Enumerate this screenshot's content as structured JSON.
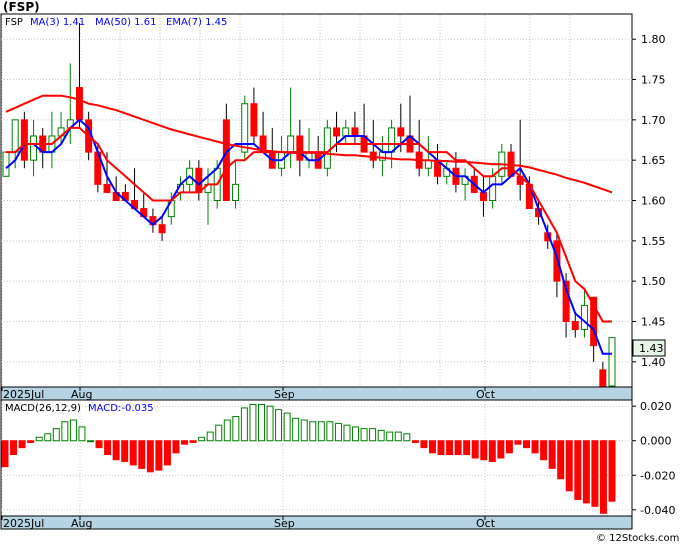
{
  "chart_data": [
    {
      "type": "candlestick",
      "title": "(FSP)",
      "legend": {
        "ticker": "FSP",
        "ma3": "MA(3)  1.41",
        "ma50": "MA(50)  1.61",
        "ema7": "EMA(7)  1.45"
      },
      "x_ticks": [
        "2025Jul",
        "Aug",
        "Sep",
        "Oct"
      ],
      "y_ticks": [
        "1.80",
        "1.75",
        "1.70",
        "1.65",
        "1.60",
        "1.55",
        "1.50",
        "1.45",
        "1.40"
      ],
      "ylim": [
        1.37,
        1.83
      ],
      "last_price": "1.43",
      "grid": true,
      "candles": [
        [
          1.63,
          1.66,
          1.63,
          1.66
        ],
        [
          1.66,
          1.7,
          1.64,
          1.7
        ],
        [
          1.7,
          1.71,
          1.64,
          1.65
        ],
        [
          1.65,
          1.7,
          1.63,
          1.68
        ],
        [
          1.68,
          1.69,
          1.64,
          1.66
        ],
        [
          1.66,
          1.71,
          1.64,
          1.68
        ],
        [
          1.68,
          1.71,
          1.67,
          1.69
        ],
        [
          1.69,
          1.77,
          1.67,
          1.7
        ],
        [
          1.74,
          1.82,
          1.69,
          1.7
        ],
        [
          1.7,
          1.71,
          1.65,
          1.66
        ],
        [
          1.66,
          1.67,
          1.61,
          1.62
        ],
        [
          1.62,
          1.66,
          1.61,
          1.61
        ],
        [
          1.61,
          1.63,
          1.6,
          1.6
        ],
        [
          1.61,
          1.62,
          1.6,
          1.6
        ],
        [
          1.6,
          1.64,
          1.59,
          1.59
        ],
        [
          1.59,
          1.61,
          1.58,
          1.58
        ],
        [
          1.58,
          1.59,
          1.56,
          1.57
        ],
        [
          1.57,
          1.58,
          1.55,
          1.56
        ],
        [
          1.58,
          1.61,
          1.57,
          1.6
        ],
        [
          1.61,
          1.63,
          1.6,
          1.62
        ],
        [
          1.62,
          1.65,
          1.61,
          1.64
        ],
        [
          1.64,
          1.65,
          1.6,
          1.61
        ],
        [
          1.61,
          1.64,
          1.57,
          1.62
        ],
        [
          1.6,
          1.65,
          1.59,
          1.64
        ],
        [
          1.7,
          1.72,
          1.64,
          1.6
        ],
        [
          1.6,
          1.65,
          1.59,
          1.62
        ],
        [
          1.66,
          1.73,
          1.65,
          1.72
        ],
        [
          1.72,
          1.74,
          1.67,
          1.68
        ],
        [
          1.68,
          1.71,
          1.66,
          1.66
        ],
        [
          1.66,
          1.69,
          1.64,
          1.64
        ],
        [
          1.64,
          1.68,
          1.63,
          1.66
        ],
        [
          1.66,
          1.74,
          1.64,
          1.68
        ],
        [
          1.68,
          1.7,
          1.63,
          1.65
        ],
        [
          1.65,
          1.69,
          1.64,
          1.66
        ],
        [
          1.66,
          1.68,
          1.64,
          1.64
        ],
        [
          1.64,
          1.7,
          1.63,
          1.69
        ],
        [
          1.69,
          1.71,
          1.66,
          1.68
        ],
        [
          1.68,
          1.7,
          1.67,
          1.69
        ],
        [
          1.69,
          1.71,
          1.67,
          1.68
        ],
        [
          1.68,
          1.72,
          1.66,
          1.66
        ],
        [
          1.66,
          1.7,
          1.64,
          1.65
        ],
        [
          1.65,
          1.68,
          1.63,
          1.66
        ],
        [
          1.66,
          1.7,
          1.64,
          1.69
        ],
        [
          1.69,
          1.72,
          1.66,
          1.68
        ],
        [
          1.68,
          1.73,
          1.66,
          1.66
        ],
        [
          1.66,
          1.7,
          1.63,
          1.64
        ],
        [
          1.64,
          1.68,
          1.63,
          1.65
        ],
        [
          1.65,
          1.67,
          1.62,
          1.63
        ],
        [
          1.63,
          1.65,
          1.62,
          1.64
        ],
        [
          1.64,
          1.66,
          1.61,
          1.62
        ],
        [
          1.62,
          1.64,
          1.6,
          1.63
        ],
        [
          1.63,
          1.64,
          1.61,
          1.61
        ],
        [
          1.61,
          1.63,
          1.58,
          1.6
        ],
        [
          1.6,
          1.64,
          1.59,
          1.63
        ],
        [
          1.63,
          1.67,
          1.62,
          1.66
        ],
        [
          1.66,
          1.67,
          1.63,
          1.63
        ],
        [
          1.63,
          1.7,
          1.6,
          1.62
        ],
        [
          1.62,
          1.63,
          1.59,
          1.59
        ],
        [
          1.59,
          1.6,
          1.57,
          1.58
        ],
        [
          1.56,
          1.57,
          1.54,
          1.55
        ],
        [
          1.55,
          1.56,
          1.48,
          1.5
        ],
        [
          1.5,
          1.51,
          1.43,
          1.45
        ],
        [
          1.45,
          1.46,
          1.43,
          1.44
        ],
        [
          1.44,
          1.49,
          1.43,
          1.47
        ],
        [
          1.48,
          1.48,
          1.4,
          1.42
        ],
        [
          1.39,
          1.4,
          1.36,
          1.36
        ],
        [
          1.37,
          1.43,
          1.37,
          1.43
        ]
      ],
      "series": [
        {
          "name": "MA(3)",
          "color": "#0000ff",
          "values": [
            1.64,
            1.65,
            1.67,
            1.67,
            1.66,
            1.66,
            1.67,
            1.69,
            1.7,
            1.69,
            1.66,
            1.63,
            1.61,
            1.6,
            1.59,
            1.58,
            1.57,
            1.58,
            1.6,
            1.62,
            1.63,
            1.62,
            1.63,
            1.64,
            1.66,
            1.67,
            1.67,
            1.67,
            1.66,
            1.65,
            1.65,
            1.66,
            1.66,
            1.65,
            1.65,
            1.66,
            1.67,
            1.68,
            1.68,
            1.68,
            1.67,
            1.66,
            1.66,
            1.67,
            1.68,
            1.67,
            1.66,
            1.65,
            1.64,
            1.63,
            1.63,
            1.62,
            1.61,
            1.62,
            1.62,
            1.63,
            1.64,
            1.62,
            1.59,
            1.56,
            1.53,
            1.49,
            1.46,
            1.45,
            1.44,
            1.41,
            1.41
          ]
        },
        {
          "name": "MA(50)",
          "color": "#ff0000",
          "values": [
            1.71,
            1.715,
            1.72,
            1.725,
            1.73,
            1.73,
            1.73,
            1.728,
            1.725,
            1.72,
            1.718,
            1.715,
            1.712,
            1.708,
            1.704,
            1.7,
            1.696,
            1.692,
            1.688,
            1.685,
            1.682,
            1.679,
            1.676,
            1.673,
            1.67,
            1.668,
            1.666,
            1.664,
            1.662,
            1.661,
            1.66,
            1.659,
            1.659,
            1.659,
            1.659,
            1.658,
            1.657,
            1.656,
            1.656,
            1.655,
            1.654,
            1.653,
            1.652,
            1.651,
            1.651,
            1.65,
            1.65,
            1.649,
            1.649,
            1.648,
            1.648,
            1.647,
            1.646,
            1.645,
            1.645,
            1.644,
            1.643,
            1.641,
            1.638,
            1.635,
            1.632,
            1.628,
            1.625,
            1.622,
            1.618,
            1.614,
            1.61
          ]
        },
        {
          "name": "EMA(7)",
          "color": "#ff0000",
          "values": [
            1.66,
            1.66,
            1.67,
            1.67,
            1.67,
            1.67,
            1.68,
            1.69,
            1.69,
            1.68,
            1.67,
            1.65,
            1.64,
            1.63,
            1.62,
            1.61,
            1.6,
            1.6,
            1.6,
            1.61,
            1.61,
            1.61,
            1.62,
            1.62,
            1.64,
            1.65,
            1.65,
            1.66,
            1.66,
            1.66,
            1.66,
            1.66,
            1.66,
            1.66,
            1.66,
            1.66,
            1.67,
            1.67,
            1.67,
            1.67,
            1.67,
            1.67,
            1.67,
            1.67,
            1.67,
            1.67,
            1.66,
            1.66,
            1.66,
            1.65,
            1.65,
            1.64,
            1.63,
            1.63,
            1.64,
            1.64,
            1.63,
            1.62,
            1.6,
            1.58,
            1.56,
            1.53,
            1.5,
            1.49,
            1.47,
            1.45,
            1.45
          ]
        }
      ]
    },
    {
      "type": "bar",
      "title": "MACD(26,12,9)",
      "subtitle": "MACD:-0.035",
      "x_ticks": [
        "2025Jul",
        "Aug",
        "Sep",
        "Oct"
      ],
      "y_ticks": [
        "0.020",
        "0.000",
        "-0.020",
        "-0.040"
      ],
      "ylim": [
        -0.043,
        0.023
      ],
      "values": [
        -0.015,
        -0.008,
        -0.004,
        -0.001,
        0.002,
        0.004,
        0.007,
        0.011,
        0.012,
        0.008,
        0.0,
        -0.004,
        -0.008,
        -0.011,
        -0.012,
        -0.014,
        -0.016,
        -0.018,
        -0.017,
        -0.014,
        -0.007,
        -0.002,
        -0.001,
        0.002,
        0.005,
        0.009,
        0.012,
        0.014,
        0.019,
        0.021,
        0.021,
        0.02,
        0.018,
        0.016,
        0.013,
        0.012,
        0.011,
        0.011,
        0.011,
        0.01,
        0.009,
        0.008,
        0.007,
        0.007,
        0.006,
        0.005,
        0.005,
        0.004,
        -0.001,
        -0.004,
        -0.007,
        -0.008,
        -0.008,
        -0.008,
        -0.008,
        -0.01,
        -0.011,
        -0.012,
        -0.01,
        -0.007,
        -0.002,
        -0.004,
        -0.007,
        -0.011,
        -0.016,
        -0.022,
        -0.029,
        -0.034,
        -0.036,
        -0.038,
        -0.042,
        -0.035
      ]
    }
  ],
  "watermark": "© 12Stocks.com"
}
